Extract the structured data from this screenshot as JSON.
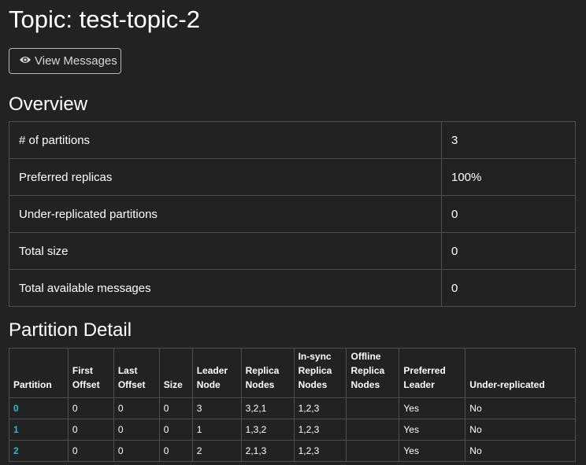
{
  "page": {
    "title": "Topic: test-topic-2",
    "view_messages_label": "View Messages"
  },
  "overview": {
    "title": "Overview",
    "rows": [
      {
        "label": "# of partitions",
        "value": "3"
      },
      {
        "label": "Preferred replicas",
        "value": "100%"
      },
      {
        "label": "Under-replicated partitions",
        "value": "0"
      },
      {
        "label": "Total size",
        "value": "0"
      },
      {
        "label": "Total available messages",
        "value": "0"
      }
    ]
  },
  "partitions": {
    "title": "Partition Detail",
    "headers": [
      "Partition",
      "First Offset",
      "Last Offset",
      "Size",
      "Leader Node",
      "Replica Nodes",
      "In-sync Replica Nodes",
      "Offline Replica Nodes",
      "Preferred Leader",
      "Under-replicated"
    ],
    "rows": [
      [
        "0",
        "0",
        "0",
        "0",
        "3",
        "3,2,1",
        "1,2,3",
        "",
        "Yes",
        "No"
      ],
      [
        "1",
        "0",
        "0",
        "0",
        "1",
        "1,3,2",
        "1,2,3",
        "",
        "Yes",
        "No"
      ],
      [
        "2",
        "0",
        "0",
        "0",
        "2",
        "2,1,3",
        "1,2,3",
        "",
        "Yes",
        "No"
      ]
    ]
  },
  "icons": {
    "view_messages": "eye-icon"
  },
  "colors": {
    "background": "#222222",
    "link": "#2eb4d6",
    "border": "#4d4d4d"
  }
}
